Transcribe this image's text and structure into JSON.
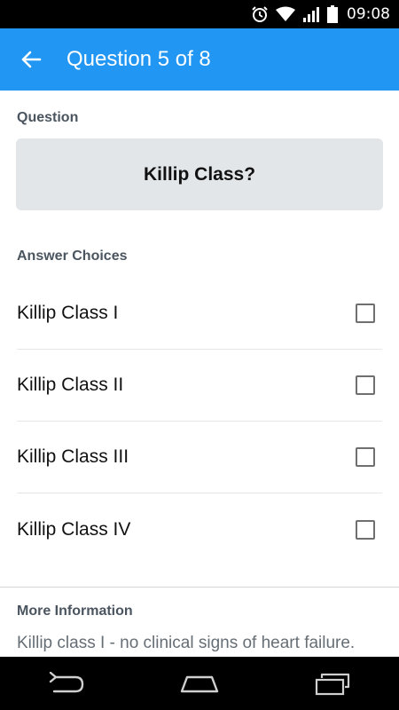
{
  "status_bar": {
    "time": "09:08",
    "icons": [
      "alarm-icon",
      "wifi-icon",
      "signal-icon",
      "battery-icon"
    ]
  },
  "app_bar": {
    "back_icon": "arrow-left-icon",
    "title": "Question 5 of 8",
    "color": "#2196F3"
  },
  "question": {
    "label": "Question",
    "text": "Killip Class?"
  },
  "answers": {
    "label": "Answer Choices",
    "choices": [
      {
        "label": "Killip Class I",
        "checked": false
      },
      {
        "label": "Killip Class II",
        "checked": false
      },
      {
        "label": "Killip Class III",
        "checked": false
      },
      {
        "label": "Killip Class IV",
        "checked": false
      }
    ]
  },
  "more_info": {
    "label": "More Information",
    "text": "Killip class I - no clinical signs of heart failure."
  },
  "nav_bar": {
    "icons": [
      "back-nav-icon",
      "home-nav-icon",
      "recents-nav-icon"
    ]
  }
}
